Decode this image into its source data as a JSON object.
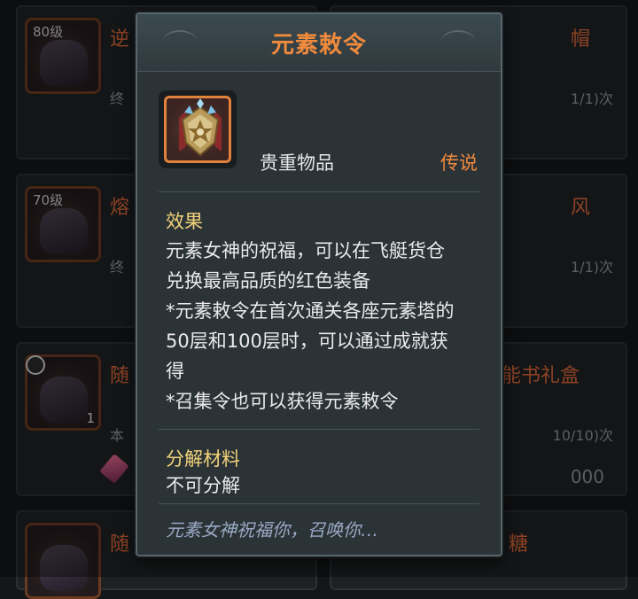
{
  "tooltip": {
    "title": "元素敕令",
    "category": "贵重物品",
    "rarity": "传说",
    "effect_heading": "效果",
    "effect_lines": [
      "元素女神的祝福，可以在飞艇货仓",
      "兑换最高品质的红色装备",
      "*元素敕令在首次通关各座元素塔的",
      "50层和100层时，可以通过成就获",
      "得",
      "*召集令也可以获得元素敕令"
    ],
    "decompose_heading": "分解材料",
    "decompose_value": "不可分解",
    "flavor": "元素女神祝福你，召唤你…"
  },
  "background_cards": {
    "left": [
      {
        "level": "80级",
        "name_partial": "逆",
        "sub_partial": "终"
      },
      {
        "level": "70级",
        "name_partial": "熔",
        "sub_partial": "终"
      },
      {
        "level": "",
        "name_partial": "随",
        "sub_partial": "本",
        "qty": "1"
      },
      {
        "level": "",
        "name_partial": "随",
        "sub_partial": ""
      }
    ],
    "right": [
      {
        "name_partial": "帽",
        "count_partial": "1/1)次"
      },
      {
        "name_partial": "风",
        "count_partial": "1/1)次"
      },
      {
        "name_partial": "能书礼盒",
        "count_partial": "10/10)次",
        "price_partial": "000"
      },
      {
        "name_partial": "糖",
        "count_partial": ""
      }
    ]
  },
  "colors": {
    "title": "#f08a3c",
    "rarity_legendary": "#f08a3c",
    "section_heading": "#f2d37a",
    "flavor": "#9aa9c4"
  },
  "icons": {
    "item": "elemental-edict-emblem-icon",
    "timer": "clock-icon",
    "gem": "gem-icon"
  }
}
